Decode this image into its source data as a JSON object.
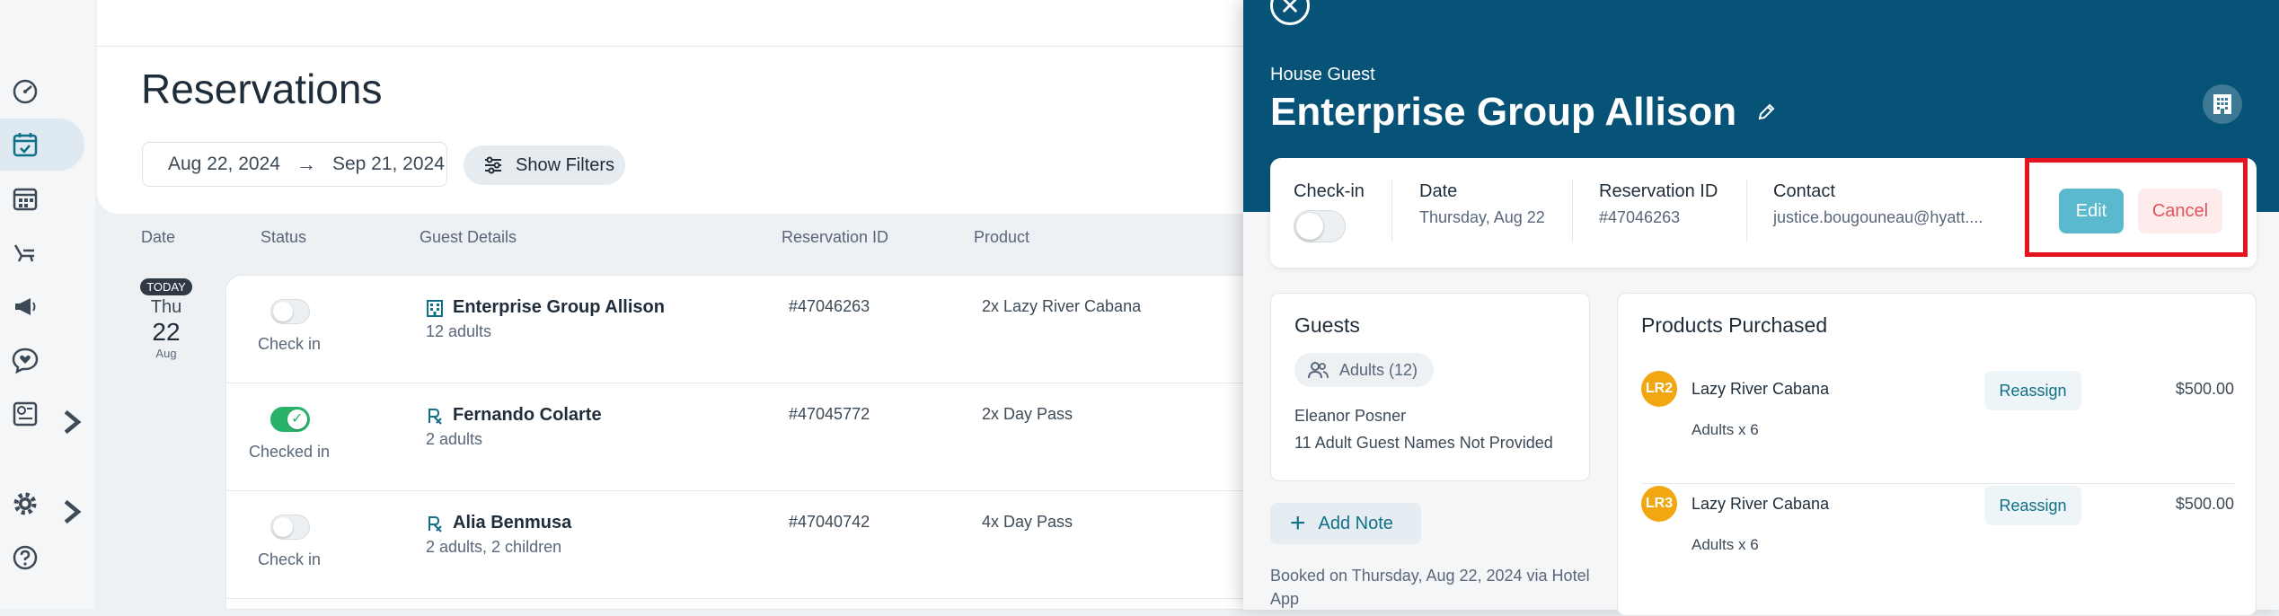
{
  "page": {
    "title": "Reservations"
  },
  "filters": {
    "date_from": "Aug 22, 2024",
    "date_arrow": "→",
    "date_to": "Sep 21, 2024",
    "show_filters_label": "Show Filters"
  },
  "columns": [
    "Date",
    "Status",
    "Guest Details",
    "Reservation ID",
    "Product"
  ],
  "date_group": {
    "today": "TODAY",
    "dow": "Thu",
    "day": "22",
    "month": "Aug"
  },
  "rows": [
    {
      "status": "Check in",
      "checked": false,
      "guest_icon": "building-icon",
      "name": "Enterprise Group Allison",
      "party": "12 adults",
      "res_id": "#47046263",
      "product": "2x Lazy River Cabana"
    },
    {
      "status": "Checked in",
      "checked": true,
      "guest_icon": "rx-icon",
      "name": "Fernando Colarte",
      "party": "2 adults",
      "res_id": "#47045772",
      "product": "2x Day Pass"
    },
    {
      "status": "Check in",
      "checked": false,
      "guest_icon": "rx-icon",
      "name": "Alia Benmusa",
      "party": "2 adults, 2 children",
      "res_id": "#47040742",
      "product": "4x Day Pass"
    }
  ],
  "drawer": {
    "close": "✕",
    "guest_type": "House Guest",
    "title": "Enterprise Group Allison",
    "info": {
      "checkin_label": "Check-in",
      "date_label": "Date",
      "date_value": "Thursday, Aug 22",
      "res_label": "Reservation ID",
      "res_value": "#47046263",
      "contact_label": "Contact",
      "contact_value": "justice.bougouneau@hyatt....",
      "edit_label": "Edit",
      "cancel_label": "Cancel"
    },
    "guests": {
      "title": "Guests",
      "chip": "Adults (12)",
      "primary": "Eleanor Posner",
      "note": "11 Adult Guest Names Not Provided"
    },
    "add_note_label": "Add Note",
    "add_note_plus": "+",
    "booked_text": "Booked on Thursday, Aug 22, 2024 via Hotel App",
    "products": {
      "title": "Products Purchased",
      "items": [
        {
          "badge": "LR2",
          "name": "Lazy River Cabana",
          "qty": "Adults x 6",
          "action": "Reassign",
          "price": "$500.00"
        },
        {
          "badge": "LR3",
          "name": "Lazy River Cabana",
          "qty": "Adults x 6",
          "action": "Reassign",
          "price": "$500.00"
        }
      ]
    }
  },
  "colors": {
    "drawer_header": "#075377",
    "edit": "#5ab9cc",
    "cancel_text": "#e0545a",
    "toggle_on": "#29b36a",
    "highlight": "#e4141f",
    "badge": "#f0a712"
  }
}
